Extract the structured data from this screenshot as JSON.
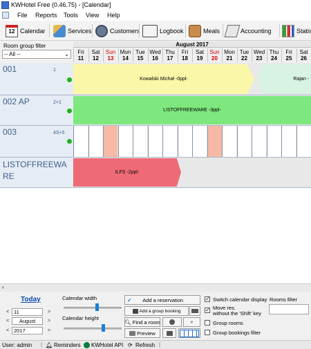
{
  "window": {
    "title": "KWHotel Free (0.46.75) - [Calendar]"
  },
  "menu": [
    "File",
    "Reports",
    "Tools",
    "View",
    "Help"
  ],
  "toolbar": {
    "calendar": "Calendar",
    "services": "Services",
    "customers": "Customers",
    "logbook": "Logbook",
    "meals": "Meals",
    "accounting": "Accounting",
    "statistics": "Statis",
    "calendar_icon_num": "12"
  },
  "filter": {
    "label": "Room group filter",
    "value": "-- All --"
  },
  "calendar": {
    "month": "August 2017",
    "days": [
      {
        "dow": "Fri",
        "num": "11"
      },
      {
        "dow": "Sat",
        "num": "12"
      },
      {
        "dow": "Sun",
        "num": "13"
      },
      {
        "dow": "Mon",
        "num": "14"
      },
      {
        "dow": "Tue",
        "num": "15"
      },
      {
        "dow": "Wed",
        "num": "16"
      },
      {
        "dow": "Thu",
        "num": "17"
      },
      {
        "dow": "Fri",
        "num": "18"
      },
      {
        "dow": "Sat",
        "num": "19"
      },
      {
        "dow": "Sun",
        "num": "20"
      },
      {
        "dow": "Mon",
        "num": "21"
      },
      {
        "dow": "Tue",
        "num": "22"
      },
      {
        "dow": "Wed",
        "num": "23"
      },
      {
        "dow": "Thu",
        "num": "24"
      },
      {
        "dow": "Fri",
        "num": "25"
      },
      {
        "dow": "Sat",
        "num": "26"
      }
    ]
  },
  "rooms": [
    {
      "name": "001",
      "capacity": "1"
    },
    {
      "name": "002 AP",
      "capacity": "2+1"
    },
    {
      "name": "003",
      "capacity": "4S+5"
    },
    {
      "name": "LISTOFFREEWARE",
      "capacity": ""
    }
  ],
  "reservations": [
    {
      "label": "Kowalski Michał -0ppl-",
      "color": "#fbf7a8"
    },
    {
      "label": "Rajan -",
      "color": "#d8f2e4"
    },
    {
      "label": "LISTOFFREEWARE -3ppl-",
      "color": "#7ee87e"
    },
    {
      "label": "ILFS -2ppl-",
      "color": "#ee6a76"
    }
  ],
  "bottom": {
    "today": "Today",
    "day": "11",
    "month": "August",
    "year": "2017",
    "calendar_width": "Calendar width",
    "calendar_height": "Calendar height",
    "add_reservation": "Add a reservation",
    "add_group_booking": "Add a group booking",
    "find_room": "Find a room",
    "preview": "Preview",
    "switch_display": "Switch calendar display",
    "move_res": "Move res.",
    "move_res2": "without the 'Shift' key",
    "group_rooms": "Group rooms",
    "group_bookings_filter": "Group bookings filter",
    "rooms_filter": "Rooms filter",
    "width_level": 0.55,
    "height_level": 0.65
  },
  "status": {
    "user": "User: admin",
    "reminders": "Reminders",
    "api": "KWHotel API",
    "refresh": "Refresh"
  }
}
